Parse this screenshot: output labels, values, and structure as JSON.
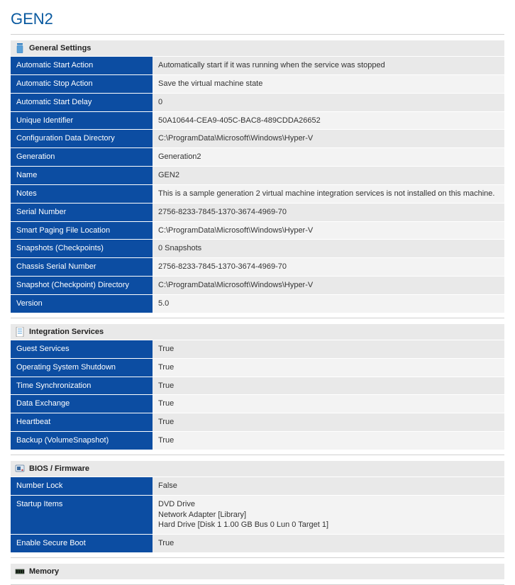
{
  "page_title": "GEN2",
  "sections": [
    {
      "icon": "settings-icon",
      "title": "General Settings",
      "rows": [
        [
          "Automatic Start Action",
          "Automatically start if it was running when the service was stopped"
        ],
        [
          "Automatic Stop Action",
          "Save the virtual machine state"
        ],
        [
          "Automatic Start Delay",
          "0"
        ],
        [
          "Unique Identifier",
          "50A10644-CEA9-405C-BAC8-489CDDA26652"
        ],
        [
          "Configuration Data Directory",
          "C:\\ProgramData\\Microsoft\\Windows\\Hyper-V"
        ],
        [
          "Generation",
          "Generation2"
        ],
        [
          "Name",
          "GEN2"
        ],
        [
          "Notes",
          "This is a sample generation 2 virtual machine integration services is not installed on this machine."
        ],
        [
          "Serial Number",
          "2756-8233-7845-1370-3674-4969-70"
        ],
        [
          "Smart Paging File Location",
          "C:\\ProgramData\\Microsoft\\Windows\\Hyper-V"
        ],
        [
          "Snapshots (Checkpoints)",
          "0 Snapshots"
        ],
        [
          "Chassis Serial Number",
          "2756-8233-7845-1370-3674-4969-70"
        ],
        [
          "Snapshot (Checkpoint) Directory",
          "C:\\ProgramData\\Microsoft\\Windows\\Hyper-V"
        ],
        [
          "Version",
          "5.0"
        ]
      ]
    },
    {
      "icon": "document-icon",
      "title": "Integration Services",
      "rows": [
        [
          "Guest Services",
          "True"
        ],
        [
          "Operating System Shutdown",
          "True"
        ],
        [
          "Time Synchronization",
          "True"
        ],
        [
          "Data Exchange",
          "True"
        ],
        [
          "Heartbeat",
          "True"
        ],
        [
          "Backup (VolumeSnapshot)",
          "True"
        ]
      ]
    },
    {
      "icon": "firmware-icon",
      "title": "BIOS / Firmware",
      "rows": [
        [
          "Number Lock",
          "False"
        ],
        [
          "Startup Items",
          "DVD Drive\nNetwork Adapter [Library]\nHard Drive [Disk 1 1.00 GB Bus 0 Lun 0 Target 1]"
        ],
        [
          "Enable Secure Boot",
          "True"
        ]
      ]
    },
    {
      "icon": "memory-icon",
      "title": "Memory",
      "rows": []
    }
  ],
  "colors": {
    "heading": "#0a5aa0",
    "key_bg": "#0c4da2",
    "val_bg": "#e9e9e9"
  }
}
